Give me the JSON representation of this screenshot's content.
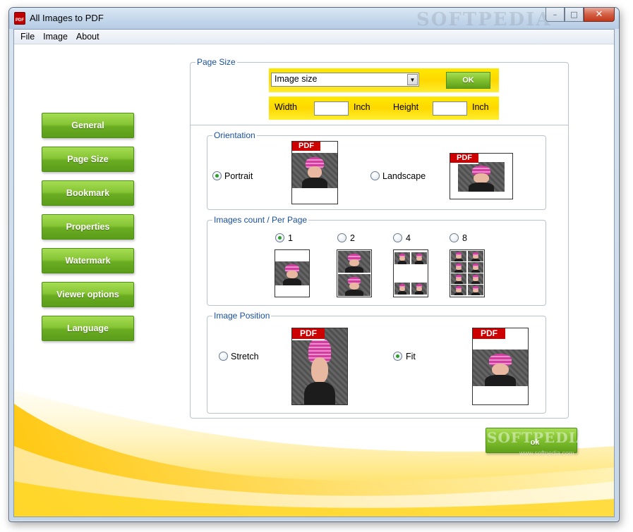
{
  "window": {
    "title": "All Images to PDF",
    "icon_text": "PDF",
    "watermark": "SOFTPEDIA"
  },
  "menu": [
    "File",
    "Image",
    "About"
  ],
  "sidebar": {
    "items": [
      {
        "label": "General"
      },
      {
        "label": "Page Size"
      },
      {
        "label": "Bookmark"
      },
      {
        "label": "Properties"
      },
      {
        "label": "Watermark"
      },
      {
        "label": "Viewer options"
      },
      {
        "label": "Language"
      }
    ]
  },
  "page_size": {
    "legend": "Page Size",
    "select_value": "Image size",
    "ok_label": "OK",
    "width_label": "Width",
    "height_label": "Height",
    "unit_label": "Inch",
    "width_value": "",
    "height_value": ""
  },
  "orientation": {
    "legend": "Orientation",
    "portrait_label": "Portrait",
    "landscape_label": "Landscape",
    "selected": "Portrait",
    "pdf_tag": "PDF"
  },
  "images_count": {
    "legend": "Images count / Per Page",
    "options": [
      "1",
      "2",
      "4",
      "8"
    ],
    "selected": "1"
  },
  "image_position": {
    "legend": "Image Position",
    "stretch_label": "Stretch",
    "fit_label": "Fit",
    "selected": "Fit",
    "pdf_tag": "PDF"
  },
  "footer": {
    "ok_label": "ok",
    "watermark": "SOFTPEDIA",
    "watermark_sub": "www.softpedia.com"
  },
  "colors": {
    "accent_green": "#7fbf2e",
    "legend_blue": "#1a4fa0",
    "band_yellow": "#ffe000",
    "pdf_red": "#cc0000"
  }
}
